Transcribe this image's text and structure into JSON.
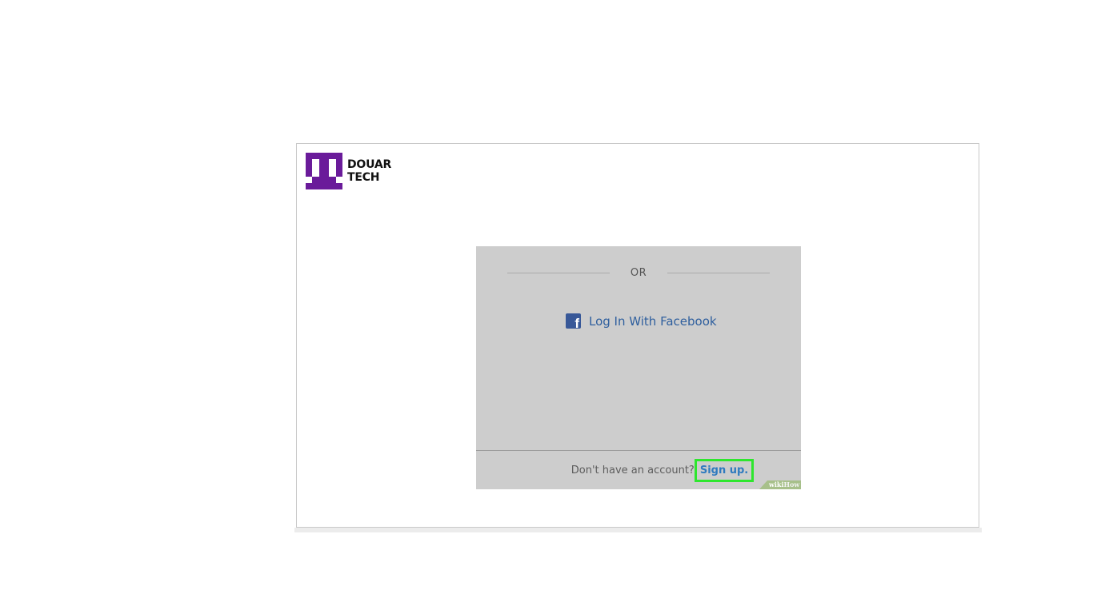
{
  "brand": {
    "line1": "DOUAR",
    "line2": "TECH",
    "logo_color": "#6a1b9a",
    "logo_icon": "douar-tech-logo"
  },
  "login": {
    "divider_text": "OR",
    "facebook_label": "Log In With Facebook",
    "facebook_icon": "facebook-icon",
    "facebook_color": "#385898"
  },
  "signup": {
    "prompt": "Don't have an account?",
    "link_label": "Sign up.",
    "highlight_color": "#2ee62e"
  },
  "watermark": {
    "wiki": "wiki",
    "how": "How"
  }
}
